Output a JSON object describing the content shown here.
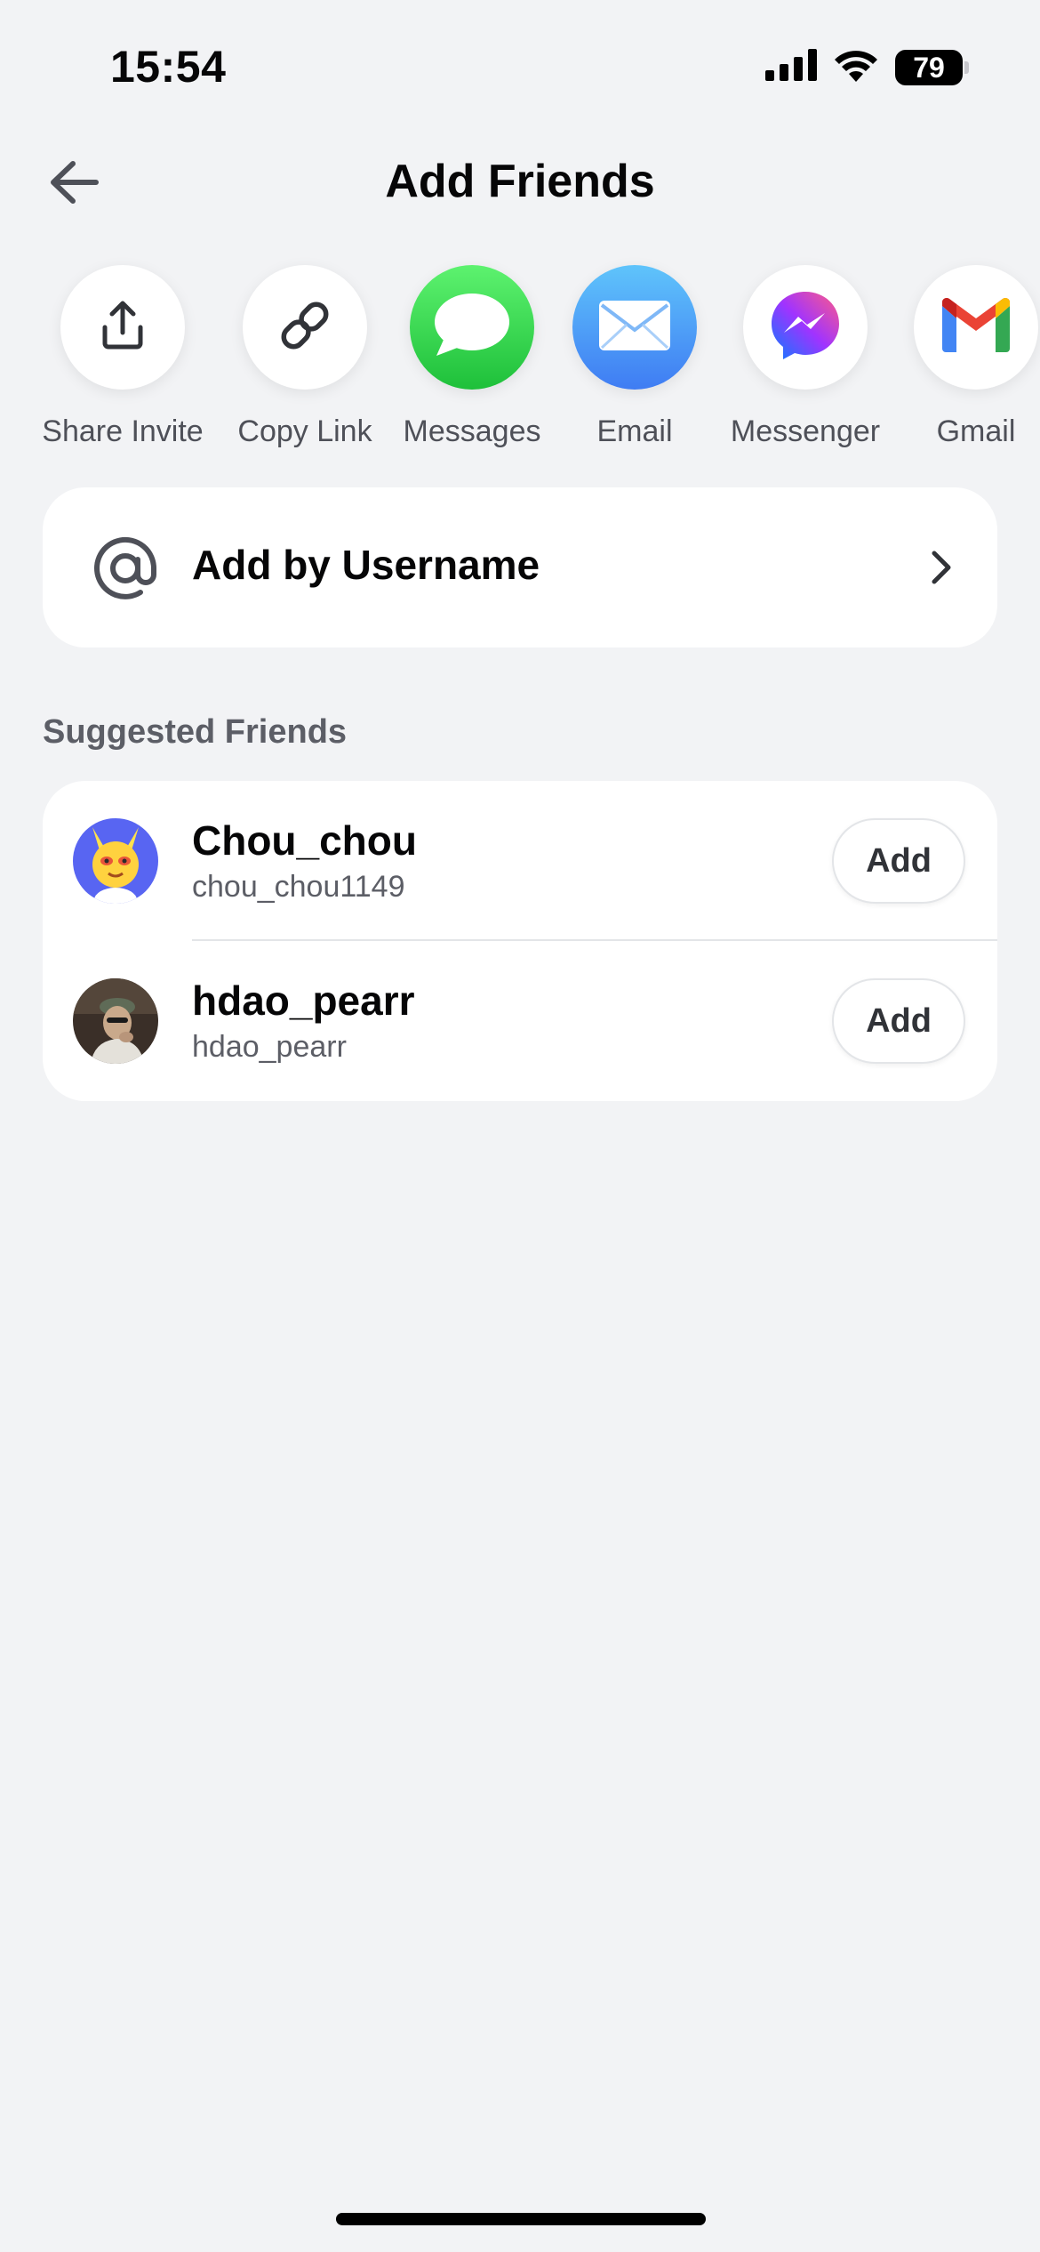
{
  "status_bar": {
    "time": "15:54",
    "battery_percent": "79",
    "battery_level": 0.79
  },
  "header": {
    "title": "Add Friends"
  },
  "share_options": [
    {
      "label": "Share Invite",
      "icon": "share-upload-icon"
    },
    {
      "label": "Copy Link",
      "icon": "link-icon"
    },
    {
      "label": "Messages",
      "icon": "messages-icon",
      "color": "#2bd34a"
    },
    {
      "label": "Email",
      "icon": "mail-icon",
      "color": "#3f8cf5"
    },
    {
      "label": "Messenger",
      "icon": "messenger-icon"
    },
    {
      "label": "Gmail",
      "icon": "gmail-icon"
    }
  ],
  "add_by_username": {
    "label": "Add by Username",
    "icon": "at-icon"
  },
  "suggested": {
    "title": "Suggested Friends",
    "friends": [
      {
        "display_name": "Chou_chou",
        "username": "chou_chou1149",
        "add_label": "Add"
      },
      {
        "display_name": "hdao_pearr",
        "username": "hdao_pearr",
        "add_label": "Add"
      }
    ]
  },
  "colors": {
    "background": "#f2f3f5",
    "card": "#ffffff",
    "text_primary": "#060607",
    "text_secondary": "#5c5e66"
  }
}
